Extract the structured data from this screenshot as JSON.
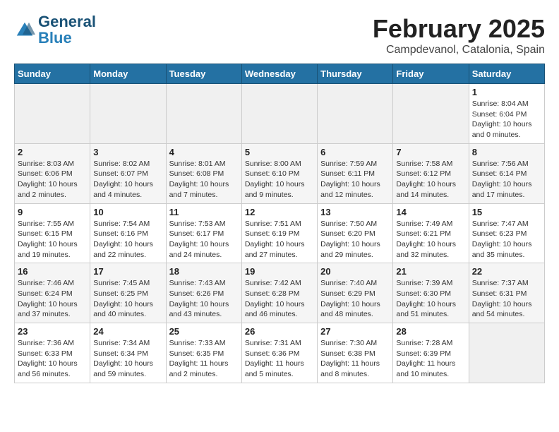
{
  "header": {
    "logo_general": "General",
    "logo_blue": "Blue",
    "month_year": "February 2025",
    "location": "Campdevanol, Catalonia, Spain"
  },
  "days_header": [
    "Sunday",
    "Monday",
    "Tuesday",
    "Wednesday",
    "Thursday",
    "Friday",
    "Saturday"
  ],
  "weeks": [
    [
      {
        "day": "",
        "info": ""
      },
      {
        "day": "",
        "info": ""
      },
      {
        "day": "",
        "info": ""
      },
      {
        "day": "",
        "info": ""
      },
      {
        "day": "",
        "info": ""
      },
      {
        "day": "",
        "info": ""
      },
      {
        "day": "1",
        "info": "Sunrise: 8:04 AM\nSunset: 6:04 PM\nDaylight: 10 hours and 0 minutes."
      }
    ],
    [
      {
        "day": "2",
        "info": "Sunrise: 8:03 AM\nSunset: 6:06 PM\nDaylight: 10 hours and 2 minutes."
      },
      {
        "day": "3",
        "info": "Sunrise: 8:02 AM\nSunset: 6:07 PM\nDaylight: 10 hours and 4 minutes."
      },
      {
        "day": "4",
        "info": "Sunrise: 8:01 AM\nSunset: 6:08 PM\nDaylight: 10 hours and 7 minutes."
      },
      {
        "day": "5",
        "info": "Sunrise: 8:00 AM\nSunset: 6:10 PM\nDaylight: 10 hours and 9 minutes."
      },
      {
        "day": "6",
        "info": "Sunrise: 7:59 AM\nSunset: 6:11 PM\nDaylight: 10 hours and 12 minutes."
      },
      {
        "day": "7",
        "info": "Sunrise: 7:58 AM\nSunset: 6:12 PM\nDaylight: 10 hours and 14 minutes."
      },
      {
        "day": "8",
        "info": "Sunrise: 7:56 AM\nSunset: 6:14 PM\nDaylight: 10 hours and 17 minutes."
      }
    ],
    [
      {
        "day": "9",
        "info": "Sunrise: 7:55 AM\nSunset: 6:15 PM\nDaylight: 10 hours and 19 minutes."
      },
      {
        "day": "10",
        "info": "Sunrise: 7:54 AM\nSunset: 6:16 PM\nDaylight: 10 hours and 22 minutes."
      },
      {
        "day": "11",
        "info": "Sunrise: 7:53 AM\nSunset: 6:17 PM\nDaylight: 10 hours and 24 minutes."
      },
      {
        "day": "12",
        "info": "Sunrise: 7:51 AM\nSunset: 6:19 PM\nDaylight: 10 hours and 27 minutes."
      },
      {
        "day": "13",
        "info": "Sunrise: 7:50 AM\nSunset: 6:20 PM\nDaylight: 10 hours and 29 minutes."
      },
      {
        "day": "14",
        "info": "Sunrise: 7:49 AM\nSunset: 6:21 PM\nDaylight: 10 hours and 32 minutes."
      },
      {
        "day": "15",
        "info": "Sunrise: 7:47 AM\nSunset: 6:23 PM\nDaylight: 10 hours and 35 minutes."
      }
    ],
    [
      {
        "day": "16",
        "info": "Sunrise: 7:46 AM\nSunset: 6:24 PM\nDaylight: 10 hours and 37 minutes."
      },
      {
        "day": "17",
        "info": "Sunrise: 7:45 AM\nSunset: 6:25 PM\nDaylight: 10 hours and 40 minutes."
      },
      {
        "day": "18",
        "info": "Sunrise: 7:43 AM\nSunset: 6:26 PM\nDaylight: 10 hours and 43 minutes."
      },
      {
        "day": "19",
        "info": "Sunrise: 7:42 AM\nSunset: 6:28 PM\nDaylight: 10 hours and 46 minutes."
      },
      {
        "day": "20",
        "info": "Sunrise: 7:40 AM\nSunset: 6:29 PM\nDaylight: 10 hours and 48 minutes."
      },
      {
        "day": "21",
        "info": "Sunrise: 7:39 AM\nSunset: 6:30 PM\nDaylight: 10 hours and 51 minutes."
      },
      {
        "day": "22",
        "info": "Sunrise: 7:37 AM\nSunset: 6:31 PM\nDaylight: 10 hours and 54 minutes."
      }
    ],
    [
      {
        "day": "23",
        "info": "Sunrise: 7:36 AM\nSunset: 6:33 PM\nDaylight: 10 hours and 56 minutes."
      },
      {
        "day": "24",
        "info": "Sunrise: 7:34 AM\nSunset: 6:34 PM\nDaylight: 10 hours and 59 minutes."
      },
      {
        "day": "25",
        "info": "Sunrise: 7:33 AM\nSunset: 6:35 PM\nDaylight: 11 hours and 2 minutes."
      },
      {
        "day": "26",
        "info": "Sunrise: 7:31 AM\nSunset: 6:36 PM\nDaylight: 11 hours and 5 minutes."
      },
      {
        "day": "27",
        "info": "Sunrise: 7:30 AM\nSunset: 6:38 PM\nDaylight: 11 hours and 8 minutes."
      },
      {
        "day": "28",
        "info": "Sunrise: 7:28 AM\nSunset: 6:39 PM\nDaylight: 11 hours and 10 minutes."
      },
      {
        "day": "",
        "info": ""
      }
    ]
  ]
}
